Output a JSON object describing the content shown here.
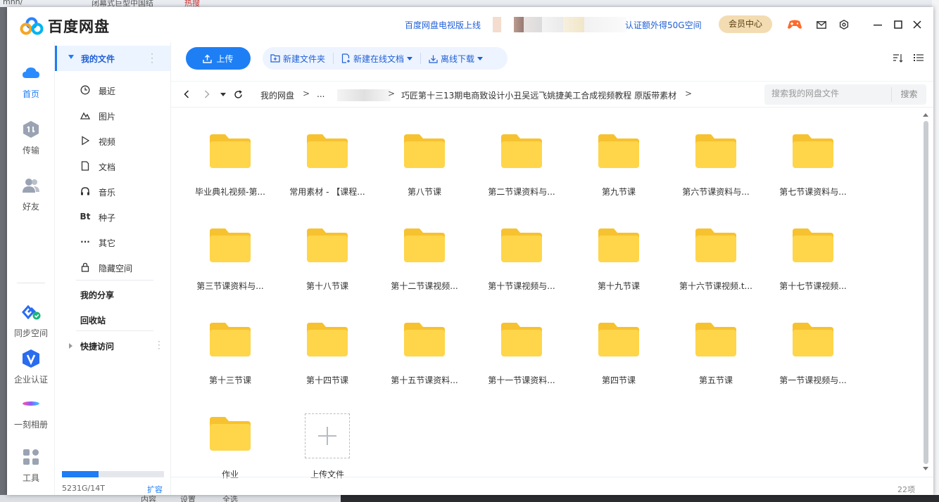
{
  "background": {
    "top_items": [
      "mhh/",
      "闭幕式巨型中国结",
      "热搜"
    ],
    "bottom_items": [
      "内容",
      "设置",
      "全选"
    ]
  },
  "titlebar": {
    "app_name": "百度网盘",
    "tv_link": "百度网盘电视版上线",
    "auth_link": "认证额外得50G空间",
    "vip_label": "会员中心",
    "icons": [
      "game-icon",
      "mail-icon",
      "settings-icon",
      "minimize-icon",
      "maximize-icon",
      "close-icon"
    ]
  },
  "rail": {
    "items": [
      {
        "label": "首页",
        "icon": "cloud-icon",
        "active": true
      },
      {
        "label": "传输",
        "icon": "transfer-icon"
      },
      {
        "label": "好友",
        "icon": "friends-icon"
      },
      {
        "label": "同步空间",
        "icon": "sync-icon"
      },
      {
        "label": "企业认证",
        "icon": "enterprise-icon"
      },
      {
        "label": "一刻相册",
        "icon": "album-icon"
      },
      {
        "label": "工具",
        "icon": "tools-icon"
      }
    ]
  },
  "sidebar": {
    "my_files": "我的文件",
    "items": [
      {
        "label": "最近",
        "icon": "clock-icon"
      },
      {
        "label": "图片",
        "icon": "image-icon"
      },
      {
        "label": "视频",
        "icon": "video-icon"
      },
      {
        "label": "文档",
        "icon": "document-icon"
      },
      {
        "label": "音乐",
        "icon": "music-icon"
      },
      {
        "label": "种子",
        "icon": "bt-icon",
        "glyph": "Bt"
      },
      {
        "label": "其它",
        "icon": "more-icon",
        "glyph": "···"
      },
      {
        "label": "隐藏空间",
        "icon": "lock-icon"
      }
    ],
    "my_share": "我的分享",
    "recycle": "回收站",
    "quick_access": "快捷访问",
    "quota_text": "5231G/14T",
    "quota_used": 0.36,
    "expand_label": "扩容"
  },
  "toolbar": {
    "upload_label": "上传",
    "new_folder": "新建文件夹",
    "new_online_doc": "新建在线文档",
    "offline_download": "离线下载"
  },
  "breadcrumb": {
    "root": "我的网盘",
    "ellipsis": "...",
    "current": "巧匠第十三13期电商致设计小丑吴远飞姚捷美工合成视频教程 原版带素材",
    "sep": ">",
    "nav_sep": "›"
  },
  "search": {
    "placeholder": "搜索我的网盘文件",
    "button": "搜索"
  },
  "files": [
    "毕业典礼视频-第...",
    "常用素材 - 【课程...",
    "第八节课",
    "第二节课资料与...",
    "第九节课",
    "第六节课资料与...",
    "第七节课资料与...",
    "第三节课资料与...",
    "第十八节课",
    "第十二节课视频...",
    "第十节课视频与...",
    "第十九节课",
    "第十六节课视频.t...",
    "第十七节课视频...",
    "第十三节课",
    "第十四节课",
    "第十五节课资料...",
    "第十一节课资料...",
    "第四节课",
    "第五节课",
    "第一节课视频与...",
    "作业"
  ],
  "upload_tile": "上传文件",
  "status": {
    "count": "22项"
  },
  "colors": {
    "accent": "#1f7cf4",
    "folder": "#ffd54a",
    "folder_tab": "#f7c22f",
    "vip": "#f3dcb2"
  }
}
